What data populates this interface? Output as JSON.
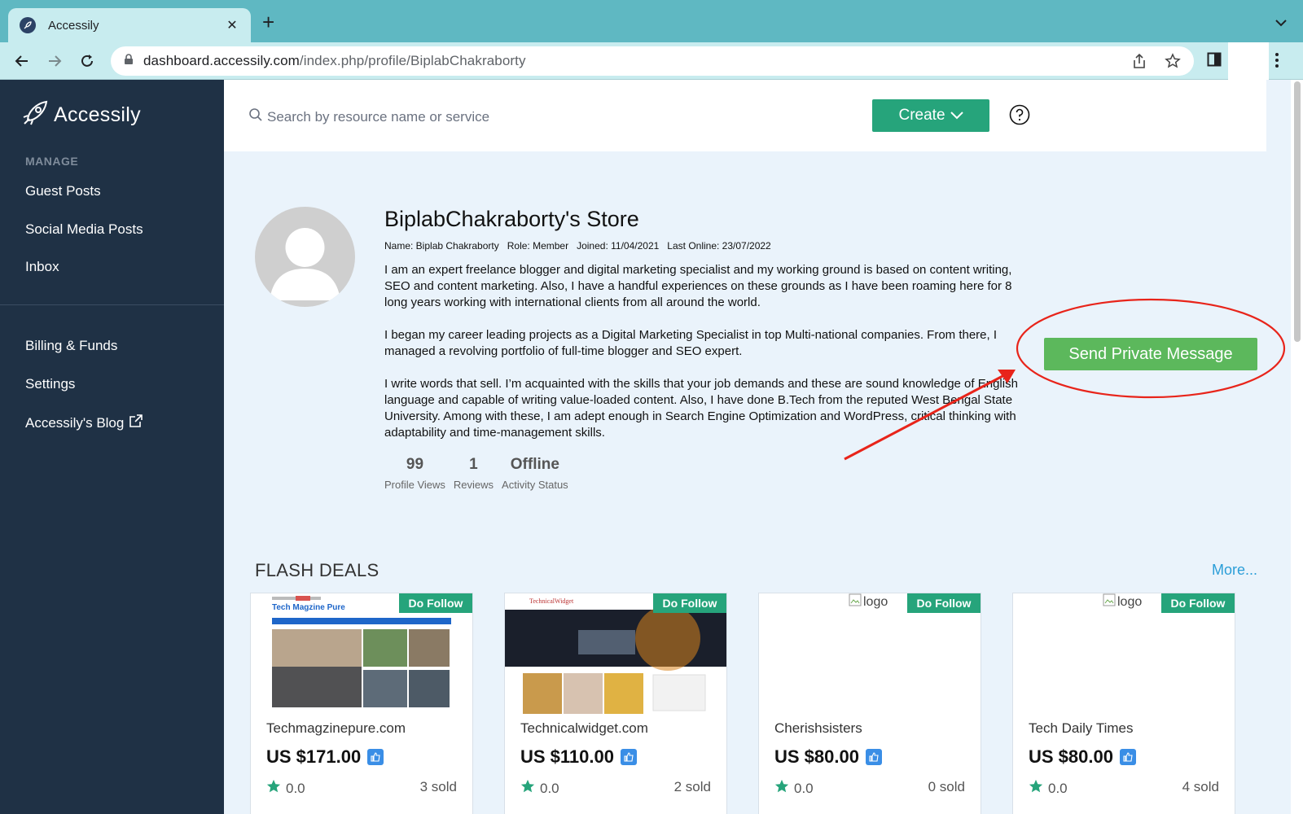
{
  "browser": {
    "tab_title": "Accessily",
    "url_host": "dashboard.accessily.com",
    "url_path": "/index.php/profile/BiplabChakraborty"
  },
  "sidebar": {
    "brand": "Accessily",
    "section_label": "MANAGE",
    "items": [
      {
        "label": "Guest Posts"
      },
      {
        "label": "Social Media Posts"
      },
      {
        "label": "Inbox"
      },
      {
        "label": "Billing & Funds"
      },
      {
        "label": "Settings"
      },
      {
        "label": "Accessily's Blog"
      }
    ]
  },
  "topbar": {
    "search_placeholder": "Search by resource name or service",
    "create_label": "Create"
  },
  "profile": {
    "store_title": "BiplabChakraborty's Store",
    "meta": {
      "name": "Name: Biplab Chakraborty",
      "role": "Role: Member",
      "joined": "Joined: 11/04/2021",
      "last_online": "Last Online: 23/07/2022"
    },
    "bio": [
      "I am an expert freelance blogger and digital marketing specialist and my working ground is based on content writing, SEO and content marketing. Also, I have a handful experiences on these grounds as I have been roaming here for 8 long years working with international clients from all around the world.",
      "I began my career leading projects as a Digital Marketing Specialist in top Multi-national companies. From there, I managed a revolving portfolio of full-time blogger and SEO expert.",
      "I write words that sell. I’m acquainted with the skills that your job demands and these are sound knowledge of English language and capable of writing value-loaded content. Also, I have done B.Tech from the reputed West Bengal State University. Among with these, I am adept enough in Search Engine Optimization and WordPress, critical thinking with adaptability and time-management skills."
    ],
    "send_message_label": "Send Private Message",
    "stats": [
      {
        "value": "99",
        "label": "Profile Views"
      },
      {
        "value": "1",
        "label": "Reviews"
      },
      {
        "value": "Offline",
        "label": "Activity Status"
      }
    ]
  },
  "flash_deals": {
    "title": "FLASH DEALS",
    "more_label": "More...",
    "cards": [
      {
        "badge": "Do Follow",
        "site": "Techmagzinepure.com",
        "price": "US $171.00",
        "rating": "0.0",
        "sold": "3 sold",
        "thumb_title": "Tech Magzine Pure"
      },
      {
        "badge": "Do Follow",
        "site": "Technicalwidget.com",
        "price": "US $110.00",
        "rating": "0.0",
        "sold": "2 sold",
        "thumb_title": "TechnicalWidget"
      },
      {
        "badge": "Do Follow",
        "site": "Cherishsisters",
        "price": "US $80.00",
        "rating": "0.0",
        "sold": "0 sold",
        "img_alt": "logo"
      },
      {
        "badge": "Do Follow",
        "site": "Tech Daily Times",
        "price": "US $80.00",
        "rating": "0.0",
        "sold": "4 sold",
        "img_alt": "logo"
      }
    ]
  },
  "colors": {
    "sidebar_bg": "#1f3145",
    "accent_green": "#26a47b",
    "send_green": "#5cb85c",
    "annotation_red": "#e8241a",
    "link_blue": "#2b9ed8"
  }
}
